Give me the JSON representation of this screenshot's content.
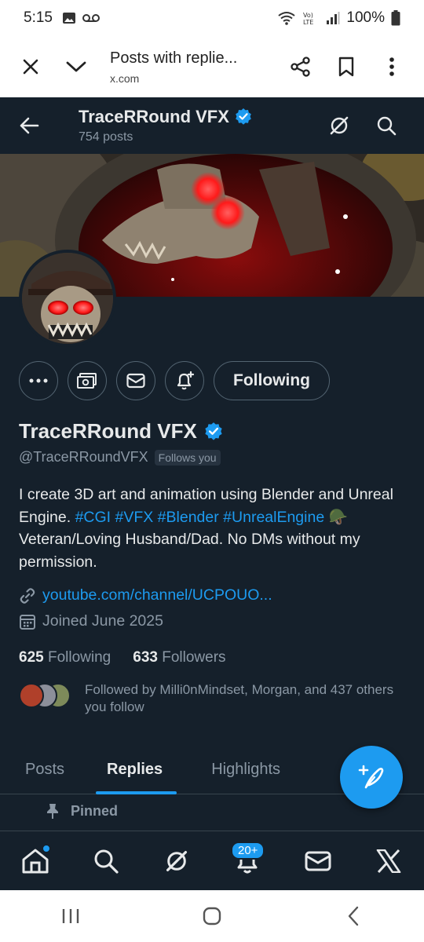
{
  "status_bar": {
    "time": "5:15",
    "battery": "100%"
  },
  "browser": {
    "title": "Posts with replie...",
    "url": "x.com"
  },
  "header": {
    "name": "TraceRRound VFX",
    "post_count": "754 posts"
  },
  "profile": {
    "name": "TraceRRound VFX",
    "handle": "@TraceRRoundVFX",
    "follows_you": "Follows you",
    "follow_button": "Following",
    "bio": {
      "text1": "I create 3D art and animation using Blender and Unreal Engine. ",
      "tags1": "#CGI #VFX #Blender",
      "tag2": "#UnrealEngine",
      "text2": " 🪖Veteran/Loving Husband/Dad. No DMs without my permission."
    },
    "link": "youtube.com/channel/UCPOUO...",
    "joined": "Joined June 2025",
    "following_count": "625",
    "following_label": "Following",
    "followers_count": "633",
    "followers_label": "Followers",
    "followed_by": "Followed by Milli0nMindset, Morgan, and 437 others you follow"
  },
  "tabs": [
    {
      "label": "Posts"
    },
    {
      "label": "Replies"
    },
    {
      "label": "Highlights"
    }
  ],
  "pinned_label": "Pinned",
  "nav": {
    "notifications_badge": "20+"
  },
  "colors": {
    "accent": "#1d9bf0",
    "bg": "#15202b",
    "muted": "#8b98a5"
  }
}
